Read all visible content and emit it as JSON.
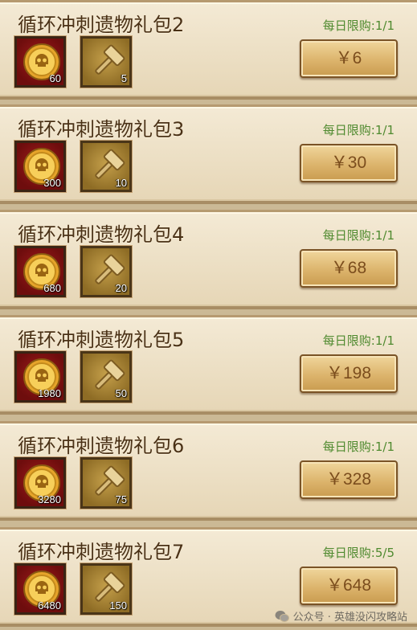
{
  "packs": [
    {
      "title": "循环冲刺遗物礼包2",
      "limit": "每日限购:1/1",
      "coin_qty": "60",
      "hammer_qty": "5",
      "price": "￥6"
    },
    {
      "title": "循环冲刺遗物礼包3",
      "limit": "每日限购:1/1",
      "coin_qty": "300",
      "hammer_qty": "10",
      "price": "￥30"
    },
    {
      "title": "循环冲刺遗物礼包4",
      "limit": "每日限购:1/1",
      "coin_qty": "680",
      "hammer_qty": "20",
      "price": "￥68"
    },
    {
      "title": "循环冲刺遗物礼包5",
      "limit": "每日限购:1/1",
      "coin_qty": "1980",
      "hammer_qty": "50",
      "price": "￥198"
    },
    {
      "title": "循环冲刺遗物礼包6",
      "limit": "每日限购:1/1",
      "coin_qty": "3280",
      "hammer_qty": "75",
      "price": "￥328"
    },
    {
      "title": "循环冲刺遗物礼包7",
      "limit": "每日限购:5/5",
      "coin_qty": "6480",
      "hammer_qty": "150",
      "price": "￥648"
    }
  ],
  "icons": {
    "item_1": "skull-coin-icon",
    "item_2": "hammer-icon"
  },
  "colors": {
    "limit_text": "#4f8a2f",
    "price_text": "#7b4d1d",
    "coin_slot_bg": "#8e1414",
    "hammer_slot_bg": "#b08a3c"
  },
  "watermark": {
    "text": "公众号 · 英雄没闪攻略站"
  }
}
